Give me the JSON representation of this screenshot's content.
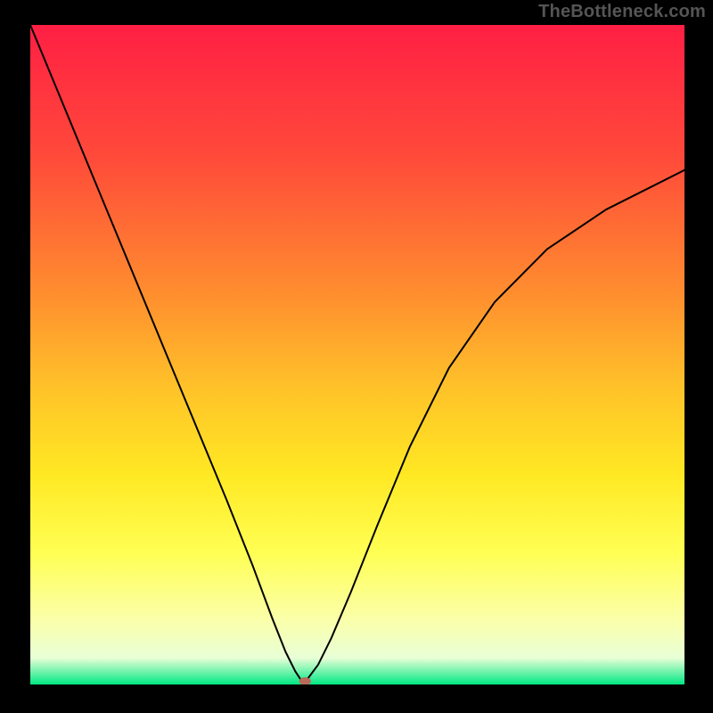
{
  "watermark": "TheBottleneck.com",
  "chart_data": {
    "type": "line",
    "title": "",
    "xlabel": "",
    "ylabel": "",
    "xlim": [
      0,
      100
    ],
    "ylim": [
      0,
      100
    ],
    "grid": false,
    "background_gradient": {
      "stops": [
        {
          "offset": 0,
          "color": "#ff1f44"
        },
        {
          "offset": 20,
          "color": "#ff4a3a"
        },
        {
          "offset": 40,
          "color": "#ff8b2f"
        },
        {
          "offset": 55,
          "color": "#ffc229"
        },
        {
          "offset": 68,
          "color": "#ffe823"
        },
        {
          "offset": 80,
          "color": "#ffff53"
        },
        {
          "offset": 90,
          "color": "#fbffa8"
        },
        {
          "offset": 96,
          "color": "#e8ffd6"
        },
        {
          "offset": 100,
          "color": "#00e884"
        }
      ]
    },
    "curve_points": {
      "x": [
        0,
        5,
        10,
        15,
        20,
        25,
        30,
        34,
        37,
        39,
        40.5,
        41.5,
        42.5,
        44,
        46,
        49,
        53,
        58,
        64,
        71,
        79,
        88,
        100
      ],
      "y": [
        100,
        88,
        76,
        64,
        52,
        40,
        28,
        18,
        10,
        5,
        2,
        0.5,
        1,
        3,
        7,
        14,
        24,
        36,
        48,
        58,
        66,
        72,
        78
      ]
    },
    "marker": {
      "x": 42,
      "y": 0.5,
      "color": "#b96a5a"
    }
  }
}
